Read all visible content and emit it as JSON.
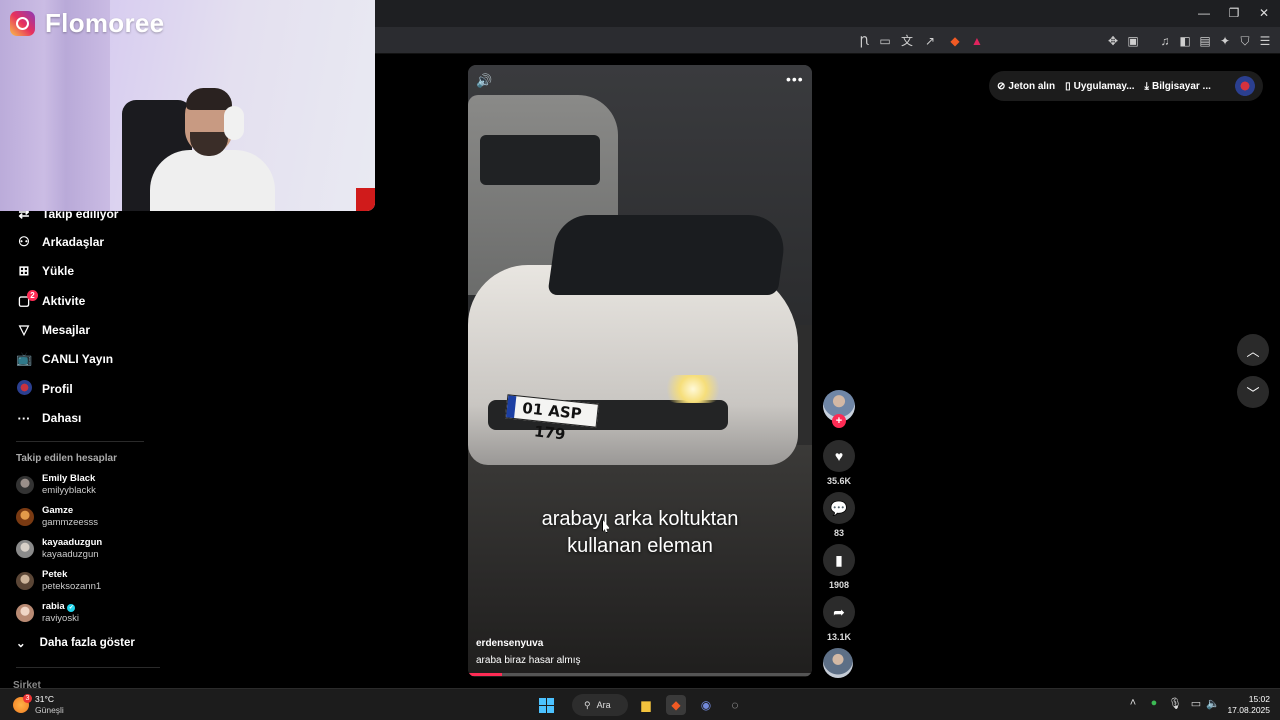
{
  "overlay": {
    "streamer_name": "Flomoree"
  },
  "sidebar": {
    "items": [
      {
        "label": "Takip ediliyor",
        "icon": "people-arrow-icon"
      },
      {
        "label": "Arkadaşlar",
        "icon": "friends-icon"
      },
      {
        "label": "Yükle",
        "icon": "upload-plus-icon"
      },
      {
        "label": "Aktivite",
        "icon": "activity-icon",
        "badge": "2"
      },
      {
        "label": "Mesajlar",
        "icon": "messages-icon"
      },
      {
        "label": "CANLI Yayın",
        "icon": "live-tv-icon"
      },
      {
        "label": "Profil",
        "icon": "profile-avatar-icon"
      },
      {
        "label": "Dahası",
        "icon": "ellipsis-icon"
      }
    ],
    "following_heading": "Takip edilen hesaplar",
    "accounts": [
      {
        "name": "Emily Black",
        "handle": "emilyyblackk"
      },
      {
        "name": "Gamze",
        "handle": "gammzeesss"
      },
      {
        "name": "kayaaduzgun",
        "handle": "kayaaduzgun"
      },
      {
        "name": "Petek",
        "handle": "peteksozann1"
      },
      {
        "name": "rabia",
        "handle": "raviyoski",
        "verified": true
      }
    ],
    "show_more": "Daha fazla göster",
    "company": "Şirket"
  },
  "video": {
    "caption_line1": "arabayı arka koltuktan",
    "caption_line2": "kullanan eleman",
    "author": "erdensenyuva",
    "description": "araba biraz hasar almış",
    "plate": "01 ASP 179",
    "progress": 0.1
  },
  "actions": {
    "likes": "35.6K",
    "comments": "83",
    "saves": "1908",
    "shares": "13.1K"
  },
  "top_actions": {
    "coins": "Jeton alın",
    "app": "Uygulamay...",
    "desktop": "Bilgisayar ..."
  },
  "taskbar": {
    "temperature": "31°C",
    "weather": "Güneşli",
    "weather_badge": "3",
    "search": "Ara",
    "time": "15:02",
    "date": "17.08.2025"
  },
  "colors": {
    "accent": "#fe2c55",
    "background": "#000000"
  }
}
